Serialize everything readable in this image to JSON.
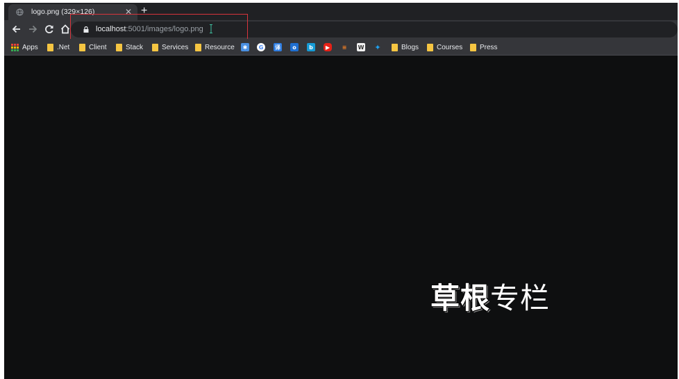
{
  "tab": {
    "title": "logo.png (329×126)",
    "close_icon": "close-icon",
    "new_tab_label": "+"
  },
  "omnibox": {
    "host": "localhost",
    "path": ":5001/images/logo.png"
  },
  "bookmarks": {
    "apps_label": "Apps",
    "folders": [
      ".Net",
      "Client",
      "Stack",
      "Services",
      "Resource"
    ],
    "icons": [
      "pinwheel-icon",
      "google-icon",
      "translate-icon",
      "outlook-icon",
      "bing-icon",
      "youtube-icon",
      "stackoverflow-icon",
      "wordpress-icon",
      "twitter-icon"
    ],
    "folders_right": [
      "Blogs",
      "Courses",
      "Press"
    ]
  },
  "image": {
    "part1": "草根",
    "part2": "专栏"
  },
  "colors": {
    "highlight": "#d9343c",
    "folder": "#f5c542",
    "background": "#0e0f10"
  }
}
